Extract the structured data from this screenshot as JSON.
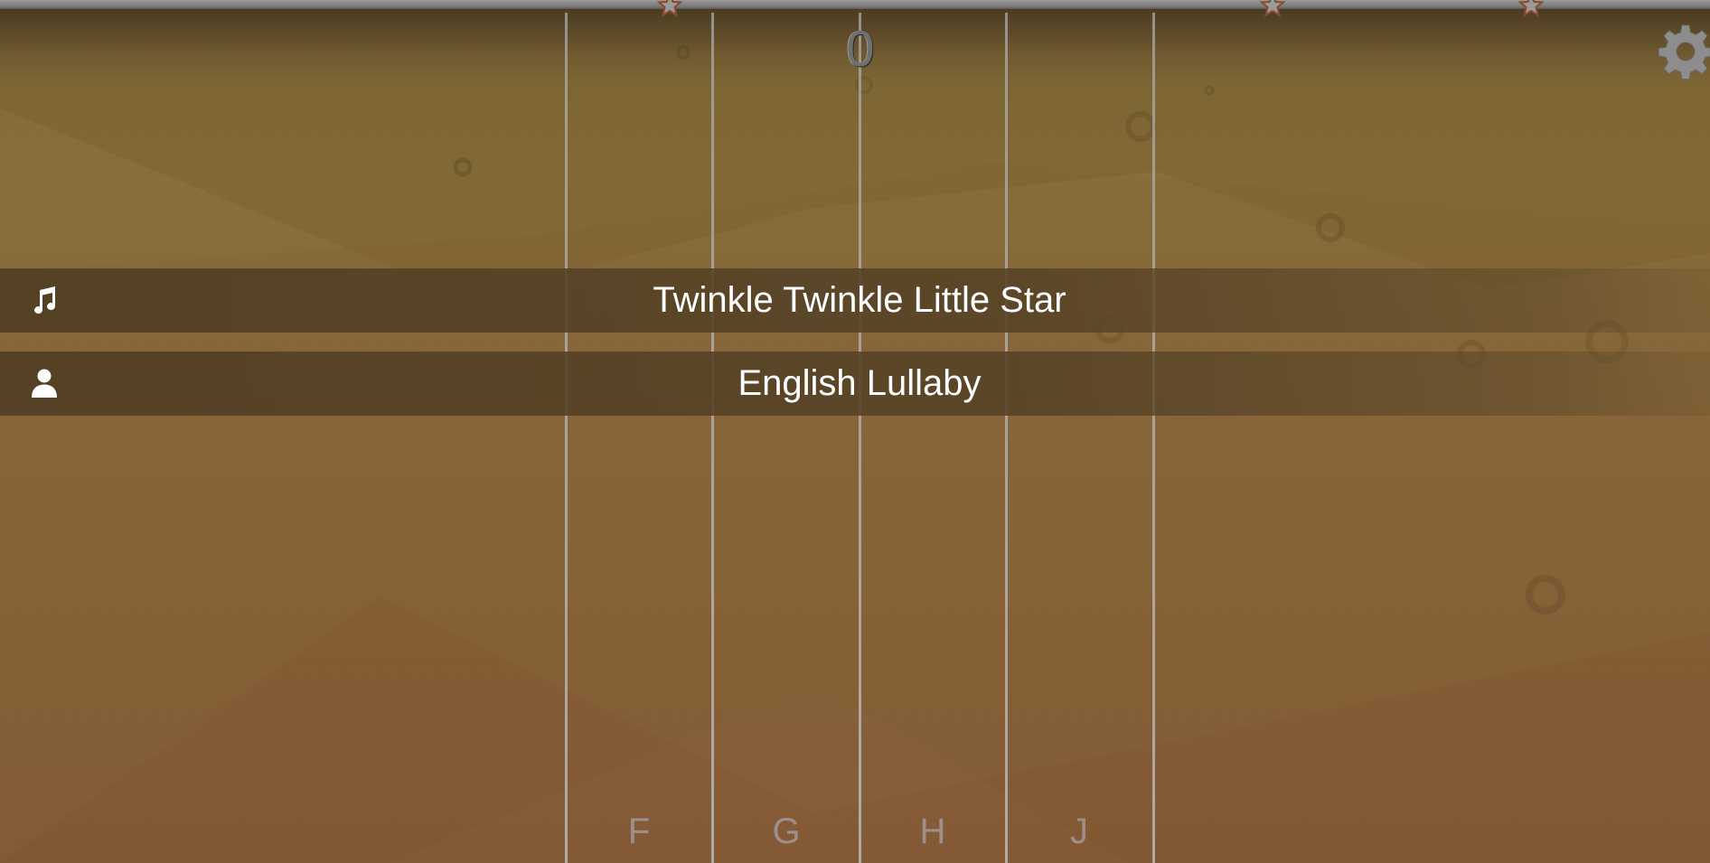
{
  "game": {
    "score": "0",
    "song_title": "Twinkle Twinkle Little Star",
    "artist": "English Lullaby",
    "keys": [
      "F",
      "G",
      "H",
      "J"
    ],
    "progress_stars": 3,
    "icons": {
      "song": "music-note-icon",
      "artist": "user-icon",
      "settings": "gear-icon",
      "progress": "star-icon"
    }
  },
  "colors": {
    "background_top": "#7c6434",
    "background_bottom": "#7e5531",
    "banner": "#4e3c22",
    "lane_line": "#aaaaaa",
    "score_text": "#6f6f6f",
    "key_label": "#a5a0aa",
    "star_outline": "#8a4a2a"
  }
}
